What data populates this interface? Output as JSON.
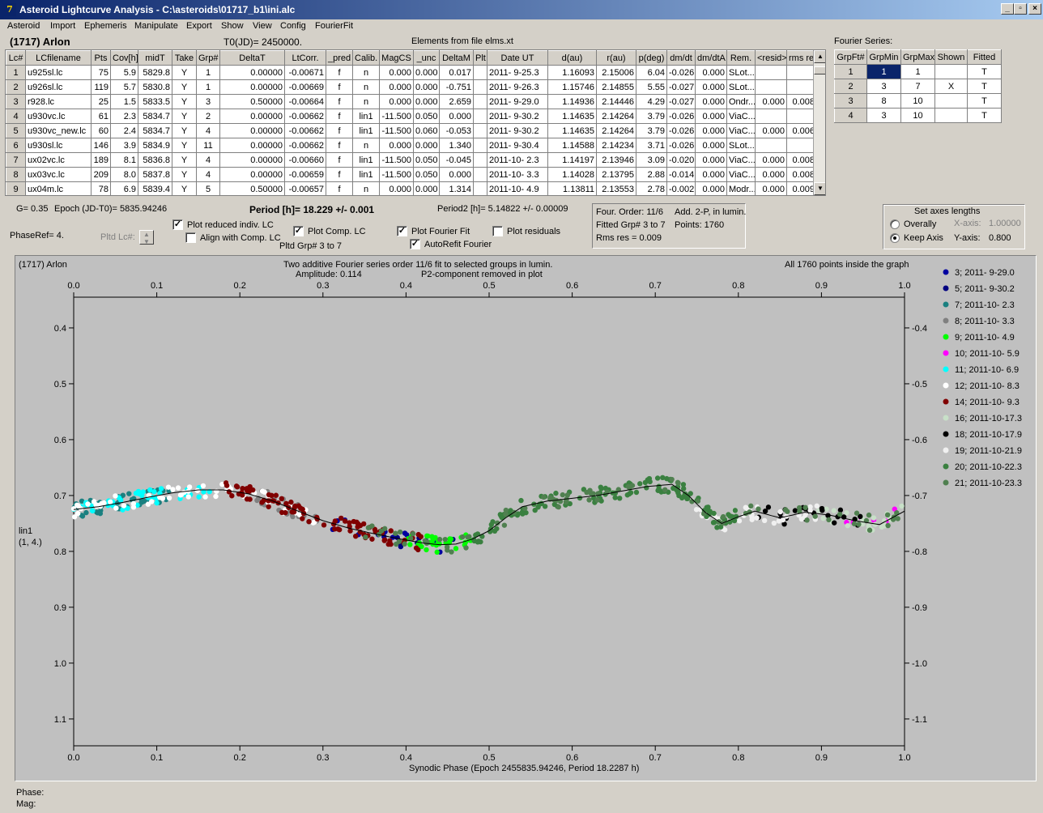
{
  "window": {
    "title": "Asteroid Lightcurve Analysis - C:\\asteroids\\01717_b1\\ini.alc",
    "icon_text": "7"
  },
  "menu": [
    "Asteroid",
    "Import",
    "Ephemeris",
    "Manipulate",
    "Export",
    "Show",
    "View",
    "Config",
    "FourierFit"
  ],
  "header": {
    "asteroid": "(1717) Arlon",
    "t0": "T0(JD)= 2450000.",
    "elements": "Elements from file elms.xt",
    "fourier_series_label": "Fourier Series:"
  },
  "lc_table": {
    "columns": [
      "Lc#",
      "LCfilename",
      "Pts",
      "Cov[h]",
      "midT",
      "Take",
      "Grp#",
      "DeltaT",
      "LtCorr.",
      "_pred",
      "Calib.",
      "MagCS",
      "_unc",
      "DeltaM",
      "Plt",
      "Date UT",
      "d(au)",
      "r(au)",
      "p(deg)",
      "dm/dt",
      "dm/dtA",
      "Rem.",
      "<resid>",
      "rms res"
    ],
    "rows": [
      [
        "1",
        "u925sl.lc",
        "75",
        "5.9",
        "5829.8",
        "Y",
        "1",
        "0.00000",
        "-0.00671",
        "f",
        "n",
        "0.000",
        "0.000",
        "0.017",
        "",
        "2011- 9-25.3",
        "1.16093",
        "2.15006",
        "6.04",
        "-0.026",
        "0.000",
        "SLot...",
        "",
        ""
      ],
      [
        "2",
        "u926sl.lc",
        "119",
        "5.7",
        "5830.8",
        "Y",
        "1",
        "0.00000",
        "-0.00669",
        "f",
        "n",
        "0.000",
        "0.000",
        "-0.751",
        "",
        "2011- 9-26.3",
        "1.15746",
        "2.14855",
        "5.55",
        "-0.027",
        "0.000",
        "SLot...",
        "",
        ""
      ],
      [
        "3",
        "r928.lc",
        "25",
        "1.5",
        "5833.5",
        "Y",
        "3",
        "0.50000",
        "-0.00664",
        "f",
        "n",
        "0.000",
        "0.000",
        "2.659",
        "",
        "2011- 9-29.0",
        "1.14936",
        "2.14446",
        "4.29",
        "-0.027",
        "0.000",
        "Ondr...",
        "0.000",
        "0.008"
      ],
      [
        "4",
        "u930vc.lc",
        "61",
        "2.3",
        "5834.7",
        "Y",
        "2",
        "0.00000",
        "-0.00662",
        "f",
        "lin1",
        "-11.500",
        "0.050",
        "0.000",
        "",
        "2011- 9-30.2",
        "1.14635",
        "2.14264",
        "3.79",
        "-0.026",
        "0.000",
        "ViaC...",
        "",
        ""
      ],
      [
        "5",
        "u930vc_new.lc",
        "60",
        "2.4",
        "5834.7",
        "Y",
        "4",
        "0.00000",
        "-0.00662",
        "f",
        "lin1",
        "-11.500",
        "0.060",
        "-0.053",
        "",
        "2011- 9-30.2",
        "1.14635",
        "2.14264",
        "3.79",
        "-0.026",
        "0.000",
        "ViaC...",
        "0.000",
        "0.006"
      ],
      [
        "6",
        "u930sl.lc",
        "146",
        "3.9",
        "5834.9",
        "Y",
        "11",
        "0.00000",
        "-0.00662",
        "f",
        "n",
        "0.000",
        "0.000",
        "1.340",
        "",
        "2011- 9-30.4",
        "1.14588",
        "2.14234",
        "3.71",
        "-0.026",
        "0.000",
        "SLot...",
        "",
        ""
      ],
      [
        "7",
        "ux02vc.lc",
        "189",
        "8.1",
        "5836.8",
        "Y",
        "4",
        "0.00000",
        "-0.00660",
        "f",
        "lin1",
        "-11.500",
        "0.050",
        "-0.045",
        "",
        "2011-10- 2.3",
        "1.14197",
        "2.13946",
        "3.09",
        "-0.020",
        "0.000",
        "ViaC...",
        "0.000",
        "0.008"
      ],
      [
        "8",
        "ux03vc.lc",
        "209",
        "8.0",
        "5837.8",
        "Y",
        "4",
        "0.00000",
        "-0.00659",
        "f",
        "lin1",
        "-11.500",
        "0.050",
        "0.000",
        "",
        "2011-10- 3.3",
        "1.14028",
        "2.13795",
        "2.88",
        "-0.014",
        "0.000",
        "ViaC...",
        "0.000",
        "0.008"
      ],
      [
        "9",
        "ux04m.lc",
        "78",
        "6.9",
        "5839.4",
        "Y",
        "5",
        "0.50000",
        "-0.00657",
        "f",
        "n",
        "0.000",
        "0.000",
        "1.314",
        "",
        "2011-10- 4.9",
        "1.13811",
        "2.13553",
        "2.78",
        "-0.002",
        "0.000",
        "Modr...",
        "0.000",
        "0.009"
      ]
    ]
  },
  "fourier_table": {
    "columns": [
      "GrpFt#",
      "GrpMin",
      "GrpMax",
      "Shown",
      "Fitted"
    ],
    "rows": [
      [
        "1",
        "1",
        "1",
        "",
        "T"
      ],
      [
        "2",
        "3",
        "7",
        "X",
        "T"
      ],
      [
        "3",
        "8",
        "10",
        "",
        "T"
      ],
      [
        "4",
        "3",
        "10",
        "",
        "T"
      ]
    ]
  },
  "controls": {
    "g_value": "G= 0.35",
    "epoch": "Epoch (JD-T0)= 5835.94246",
    "period": "Period [h]= 18.229 +/- 0.001",
    "period2": "Period2 [h]= 5.14822 +/- 0.00009",
    "phaseref": "PhaseRef= 4.",
    "pltd_lc": "Pltd Lc#:",
    "pltd_grp": "Pltd Grp#  3   to   7",
    "plot_reduced": "Plot reduced indiv. LC",
    "align_comp": "Align with Comp. LC",
    "plot_comp": "Plot Comp. LC",
    "plot_fourier": "Plot Fourier Fit",
    "autorefit": "AutoRefit Fourier",
    "plot_residuals": "Plot residuals",
    "info_line1a": "Four. Order: 11/6",
    "info_line1b": "Add. 2-P, in lumin.",
    "info_line2a": "Fitted Grp# 3 to 7",
    "info_line2b": "Points: 1760",
    "info_line3": "Rms res      = 0.009",
    "axes_title": "Set axes lengths",
    "overally": "Overally",
    "keep_axis": "Keep Axis",
    "xaxis_label": "X-axis:",
    "xaxis_value": "1.00000",
    "yaxis_label": "Y-axis:",
    "yaxis_value": "0.800"
  },
  "plot": {
    "corner_title": "(1717) Arlon",
    "title_line1": "Two additive Fourier series order 11/6 fit to selected groups in lumin.",
    "title_line2a": "Amplitude: 0.114",
    "title_line2b": "P2-component removed in plot",
    "points_note": "All 1760 points inside the graph",
    "ylabel_line1": "lin1",
    "ylabel_line2": "(1, 4.)",
    "xlabel": "Synodic Phase (Epoch 2455835.94246, Period 18.2287 h)",
    "background": "#c0c0c0"
  },
  "status": {
    "phase_label": "Phase:",
    "mag_label": "Mag:"
  },
  "chart_data": {
    "type": "scatter",
    "xlim": [
      0.0,
      1.0
    ],
    "ylim": [
      0.6,
      1.15
    ],
    "y_inverted": true,
    "x_ticks": [
      "0.0",
      "0.1",
      "0.2",
      "0.3",
      "0.4",
      "0.5",
      "0.6",
      "0.7",
      "0.8",
      "0.9",
      "1.0"
    ],
    "y_ticks": [
      "0.4",
      "0.5",
      "0.6",
      "0.7",
      "0.8",
      "0.9",
      "1.0",
      "1.1"
    ],
    "y_tick_values": [
      0.4,
      0.5,
      0.6,
      0.7,
      0.8,
      0.9,
      1.0,
      1.1
    ],
    "legend_position": "right",
    "fit_curve": {
      "color": "#000000",
      "x": [
        0.0,
        0.03,
        0.06,
        0.09,
        0.12,
        0.15,
        0.18,
        0.21,
        0.24,
        0.27,
        0.3,
        0.33,
        0.36,
        0.39,
        0.42,
        0.44,
        0.46,
        0.48,
        0.5,
        0.52,
        0.54,
        0.57,
        0.6,
        0.63,
        0.66,
        0.69,
        0.72,
        0.74,
        0.76,
        0.78,
        0.8,
        0.82,
        0.85,
        0.88,
        0.91,
        0.94,
        0.97,
        1.0
      ],
      "y": [
        0.725,
        0.72,
        0.712,
        0.703,
        0.695,
        0.69,
        0.69,
        0.697,
        0.71,
        0.728,
        0.745,
        0.758,
        0.768,
        0.777,
        0.785,
        0.788,
        0.787,
        0.778,
        0.763,
        0.74,
        0.72,
        0.71,
        0.705,
        0.7,
        0.692,
        0.684,
        0.68,
        0.7,
        0.73,
        0.75,
        0.738,
        0.728,
        0.74,
        0.73,
        0.735,
        0.745,
        0.752,
        0.728
      ]
    },
    "series": [
      {
        "name": "3; 2011- 9-29.0",
        "color": "#0000a0"
      },
      {
        "name": "5; 2011- 9-30.2",
        "color": "#000080"
      },
      {
        "name": "7; 2011-10- 2.3",
        "color": "#1a8080"
      },
      {
        "name": "8; 2011-10- 3.3",
        "color": "#808080"
      },
      {
        "name": "9; 2011-10- 4.9",
        "color": "#00ff00"
      },
      {
        "name": "10; 2011-10- 5.9",
        "color": "#ff00ff"
      },
      {
        "name": "11; 2011-10- 6.9",
        "color": "#00ffff"
      },
      {
        "name": "12; 2011-10- 8.3",
        "color": "#ffffff"
      },
      {
        "name": "14; 2011-10- 9.3",
        "color": "#800000"
      },
      {
        "name": "16; 2011-10-17.3",
        "color": "#c8e0c8"
      },
      {
        "name": "18; 2011-10-17.9",
        "color": "#000000"
      },
      {
        "name": "19; 2011-10-21.9",
        "color": "#f0f0f0"
      },
      {
        "name": "20; 2011-10-22.3",
        "color": "#3a8040"
      },
      {
        "name": "21; 2011-10-23.3",
        "color": "#508050"
      }
    ]
  }
}
